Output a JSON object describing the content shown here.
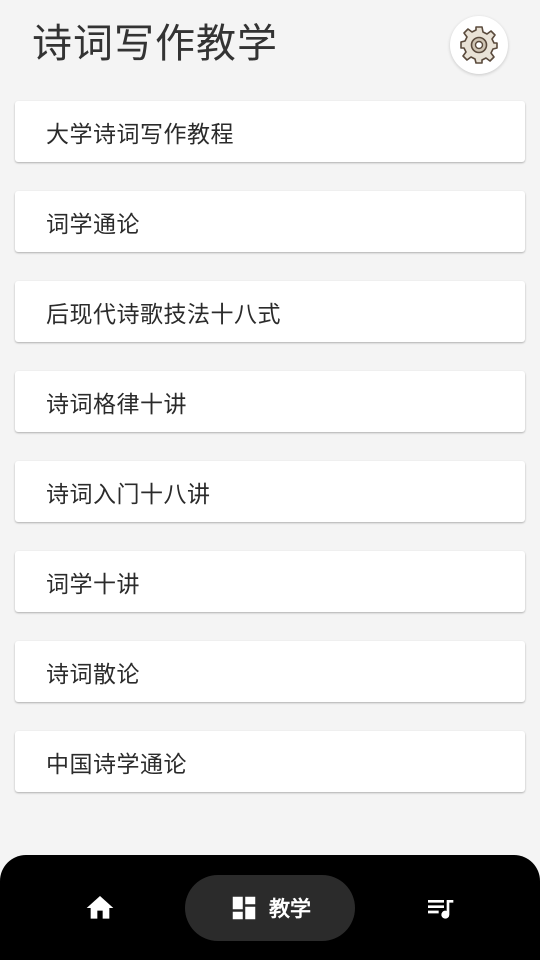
{
  "header": {
    "title": "诗词写作教学",
    "settings_icon": "gear-icon"
  },
  "courses": [
    {
      "label": "大学诗词写作教程"
    },
    {
      "label": "词学通论"
    },
    {
      "label": "后现代诗歌技法十八式"
    },
    {
      "label": "诗词格律十讲"
    },
    {
      "label": "诗词入门十八讲"
    },
    {
      "label": "词学十讲"
    },
    {
      "label": "诗词散论"
    },
    {
      "label": "中国诗学通论"
    }
  ],
  "bottom_nav": {
    "home_icon": "home-icon",
    "teach": {
      "label": "教学",
      "icon": "dashboard-icon"
    },
    "playlist_icon": "playlist-music-icon",
    "active": "teach"
  },
  "colors": {
    "background": "#f4f4f4",
    "card": "#ffffff",
    "nav_bar": "#000000",
    "nav_active_pill": "#2b2b2b"
  }
}
